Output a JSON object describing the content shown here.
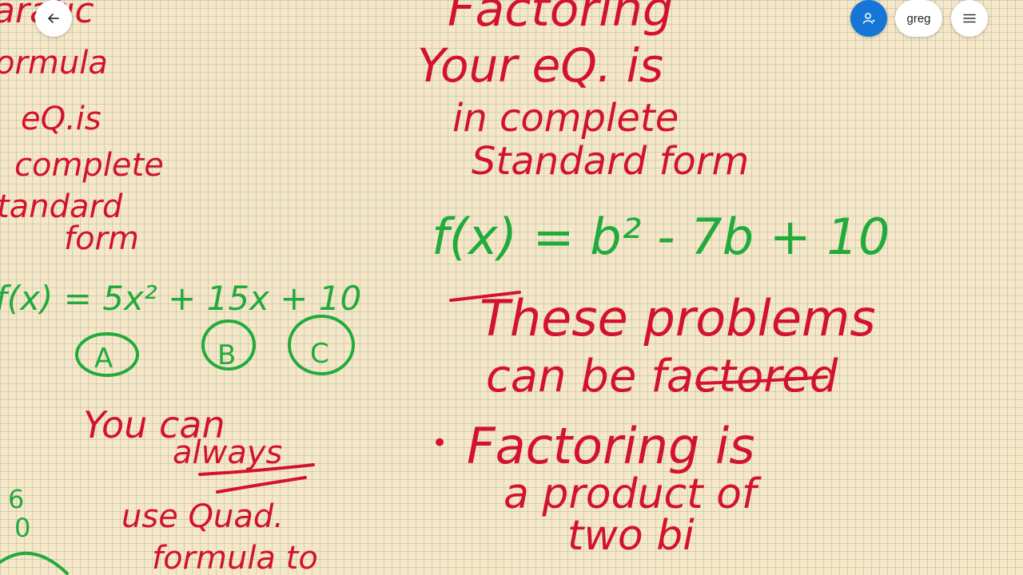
{
  "toolbar": {
    "back_icon": "arrow-left-icon",
    "avatar_icon": "person-icon",
    "user_name": "greg",
    "menu_icon": "hamburger-menu-icon",
    "accent_color": "#1576d8"
  },
  "colors": {
    "paper": "#f8e7c6",
    "grid": "#9ccaca",
    "red_ink": "#d2122e",
    "green_ink": "#22aa3c"
  },
  "left_page": {
    "heading_partial": "aratic",
    "formula_partial": "ormula",
    "line1": "eQ.is",
    "line2": "complete",
    "line3": "tandard",
    "line4": "form",
    "equation": "f(x) = 5x² + 15x + 10",
    "label_a": "A",
    "label_b": "B",
    "label_c": "C",
    "note1": "You can",
    "note2": "always",
    "note3": "use Quad.",
    "note4": "formula to",
    "margin_1": "6",
    "margin_2": "0"
  },
  "right_page": {
    "heading_partial": "Factoring",
    "line1": "Your eQ. is",
    "line2": "in complete",
    "line3": "Standard form",
    "equation": "f(x) = b² - 7b + 10",
    "line4": "These problems",
    "line5": "can be factored",
    "bullet": "•",
    "line6": "Factoring is",
    "line7": "a product of",
    "line8": "two bi"
  }
}
